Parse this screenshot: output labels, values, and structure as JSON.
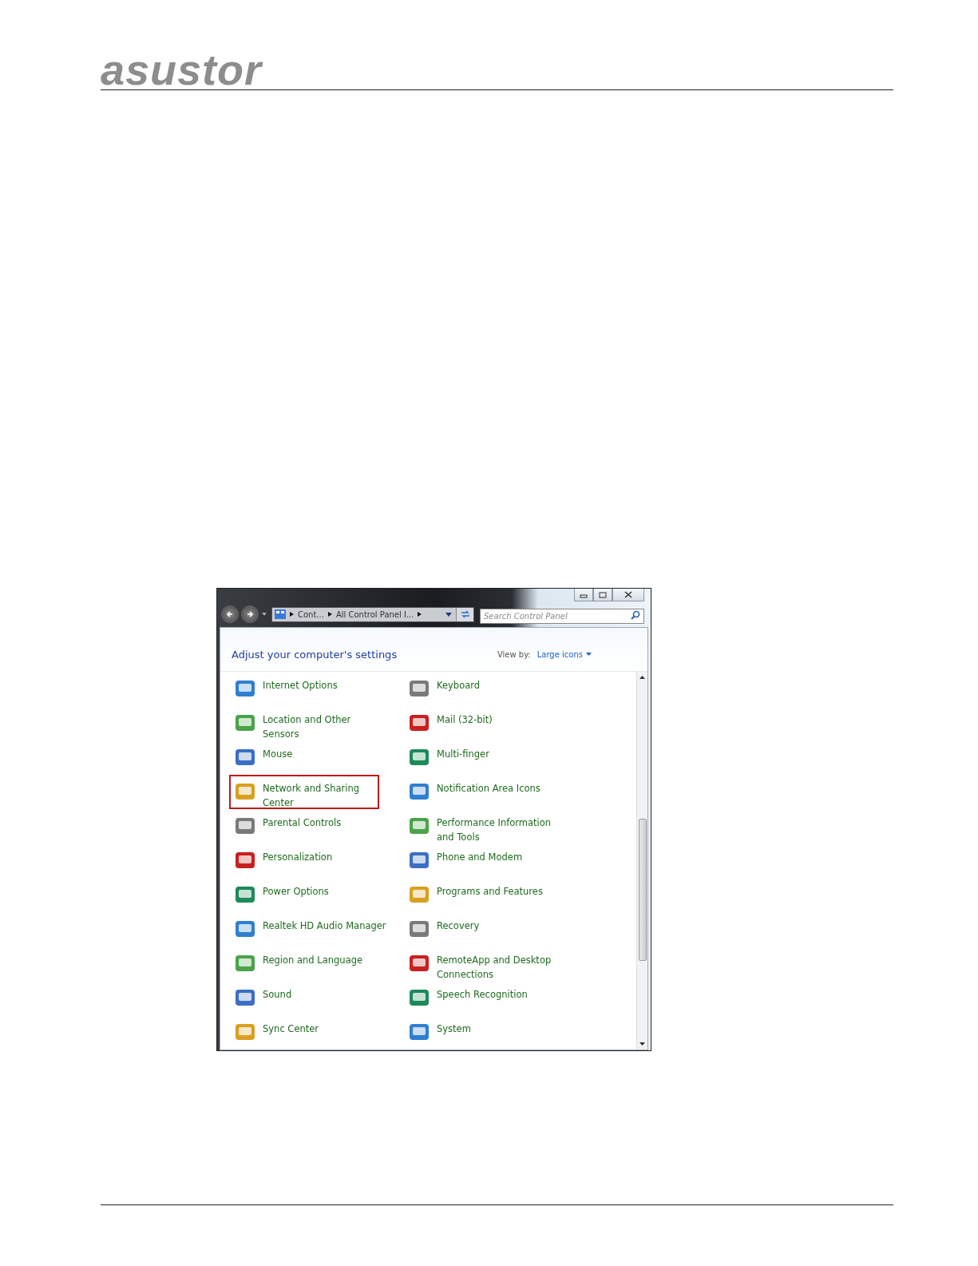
{
  "header": {
    "logo": "asustor"
  },
  "window": {
    "address": {
      "crumbs": [
        "Cont...",
        "All Control Panel I..."
      ]
    },
    "search": {
      "placeholder": "Search Control Panel"
    },
    "heading": "Adjust your computer's settings",
    "view_by": {
      "label": "View by:",
      "value": "Large icons"
    },
    "items": [
      {
        "label": "Internet Options",
        "highlighted": false
      },
      {
        "label": "Keyboard",
        "highlighted": false
      },
      {
        "label": "Location and Other Sensors",
        "highlighted": false
      },
      {
        "label": "Mail (32-bit)",
        "highlighted": false
      },
      {
        "label": "Mouse",
        "highlighted": false
      },
      {
        "label": "Multi-finger",
        "highlighted": false
      },
      {
        "label": "Network and Sharing Center",
        "highlighted": true
      },
      {
        "label": "Notification Area Icons",
        "highlighted": false
      },
      {
        "label": "Parental Controls",
        "highlighted": false
      },
      {
        "label": "Performance Information and Tools",
        "highlighted": false
      },
      {
        "label": "Personalization",
        "highlighted": false
      },
      {
        "label": "Phone and Modem",
        "highlighted": false
      },
      {
        "label": "Power Options",
        "highlighted": false
      },
      {
        "label": "Programs and Features",
        "highlighted": false
      },
      {
        "label": "Realtek HD Audio Manager",
        "highlighted": false
      },
      {
        "label": "Recovery",
        "highlighted": false
      },
      {
        "label": "Region and Language",
        "highlighted": false
      },
      {
        "label": "RemoteApp and Desktop Connections",
        "highlighted": false
      },
      {
        "label": "Sound",
        "highlighted": false
      },
      {
        "label": "Speech Recognition",
        "highlighted": false
      },
      {
        "label": "Sync Center",
        "highlighted": false
      },
      {
        "label": "System",
        "highlighted": false
      }
    ]
  }
}
